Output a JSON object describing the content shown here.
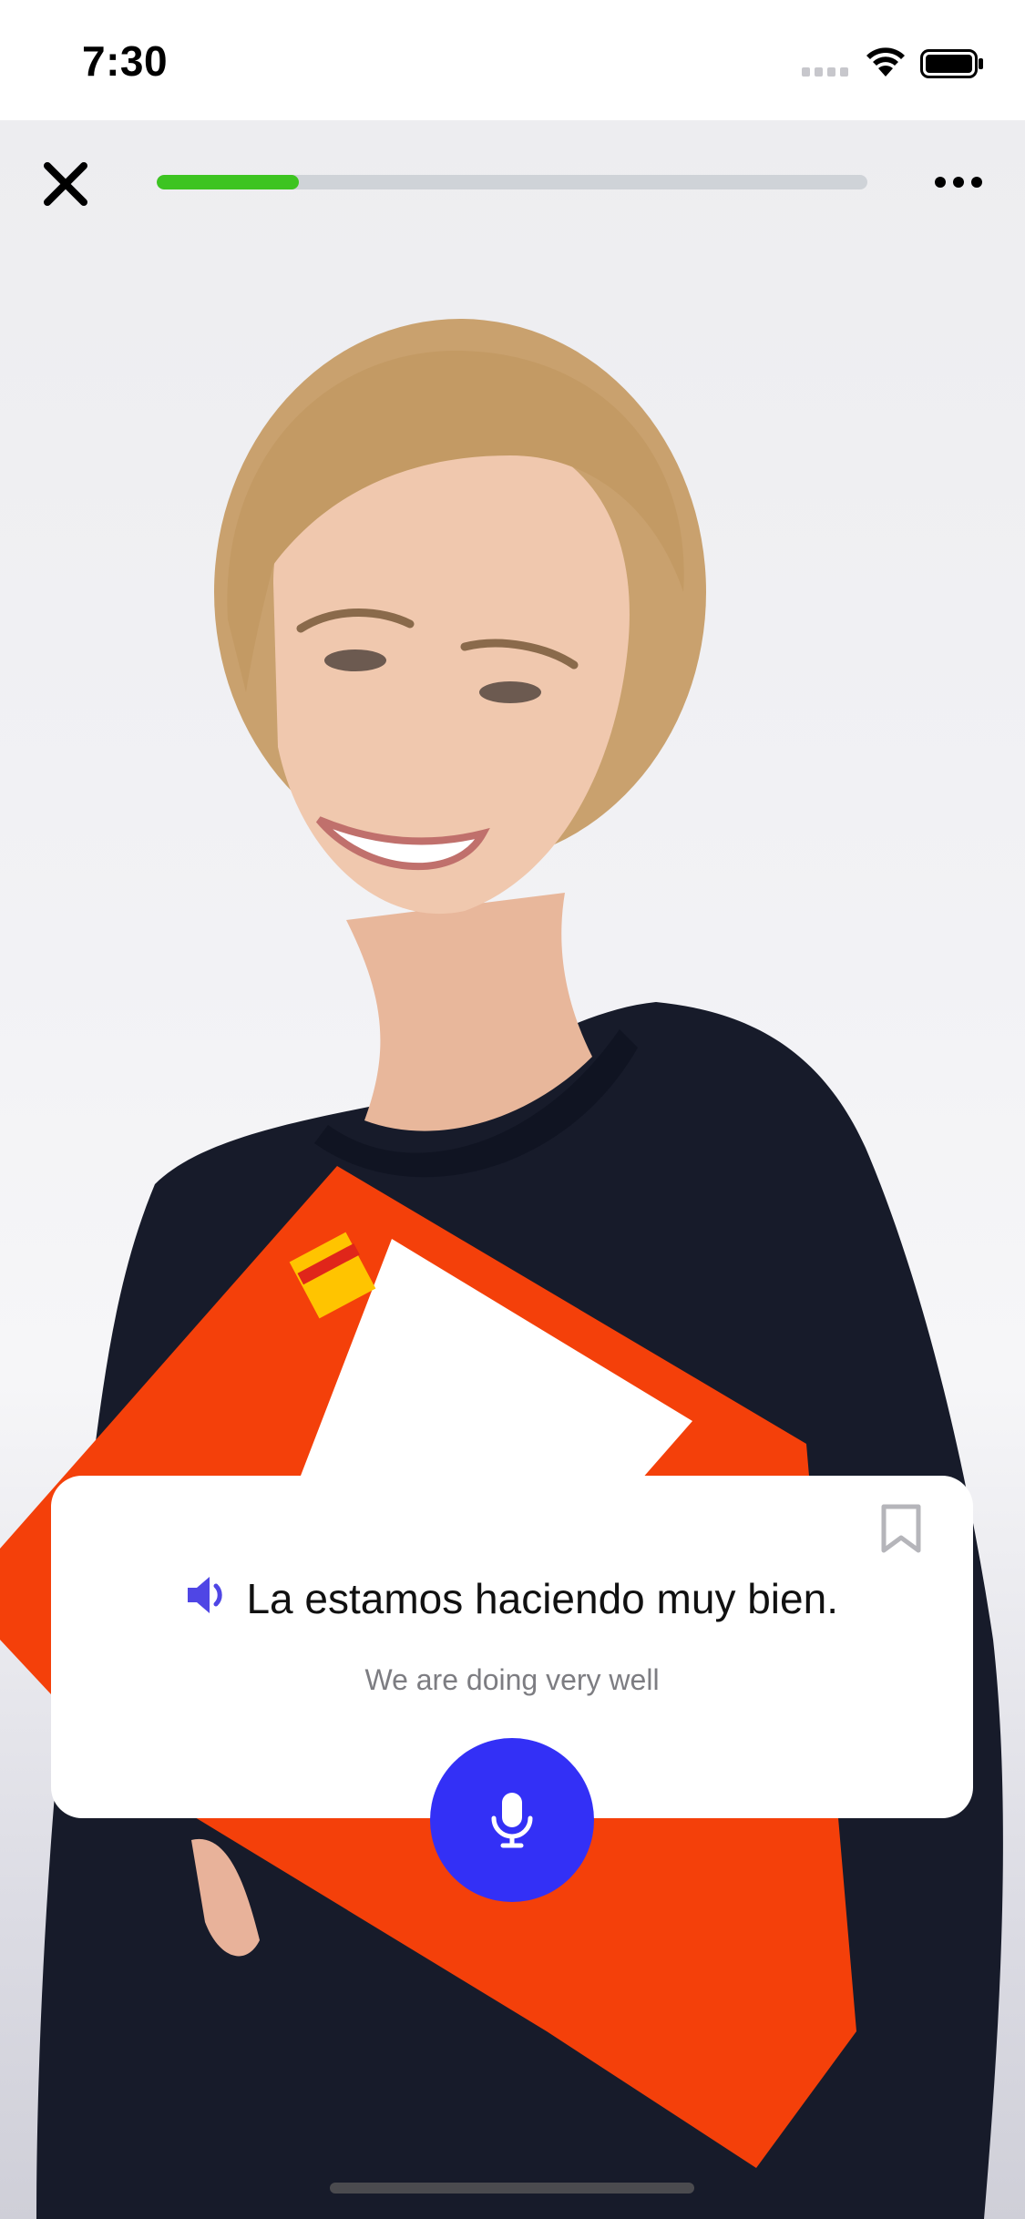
{
  "status_bar": {
    "time": "7:30"
  },
  "lesson": {
    "progress_percent": 20
  },
  "card": {
    "phrase": "La estamos haciendo muy bien.",
    "translation": "We are doing very well"
  },
  "colors": {
    "progress_fill": "#3dc421",
    "progress_track": "#cfd3d8",
    "mic_button": "#3330f6",
    "speaker_icon": "#4f46e5",
    "book": "#f4400a"
  },
  "icons": {
    "close": "close-icon",
    "more": "more-icon",
    "bookmark": "bookmark-icon",
    "speaker": "speaker-icon",
    "microphone": "microphone-icon"
  }
}
